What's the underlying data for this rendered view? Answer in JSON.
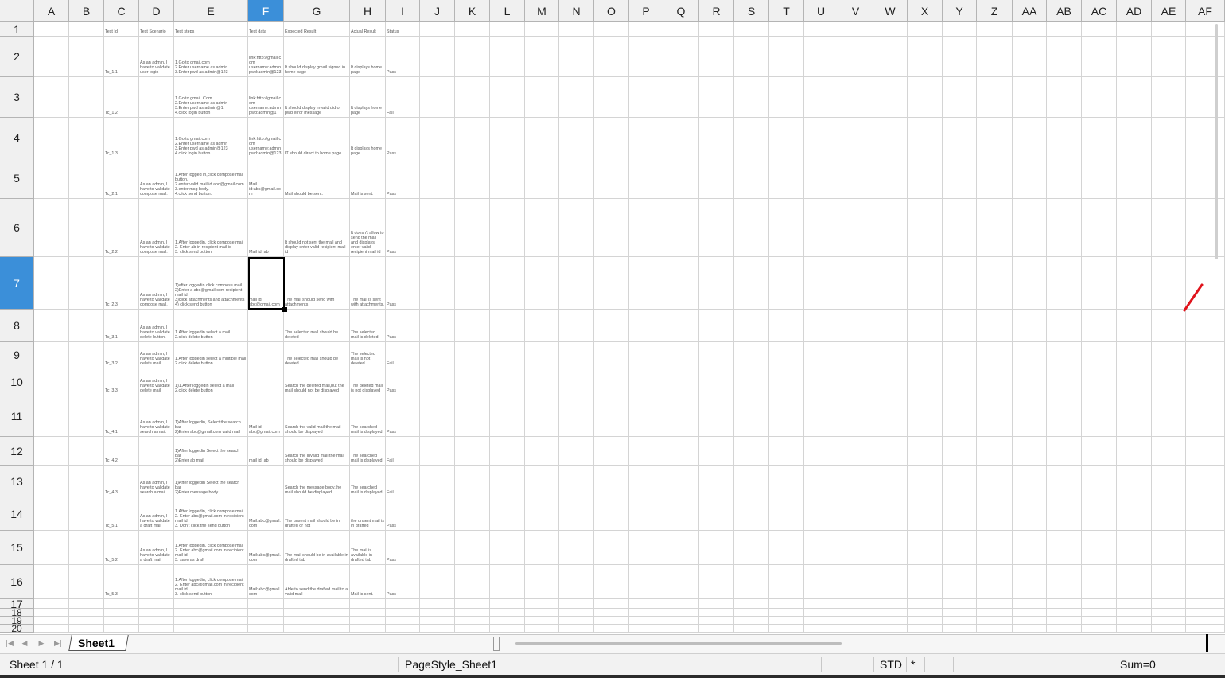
{
  "column_headers": [
    "A",
    "B",
    "C",
    "D",
    "E",
    "F",
    "G",
    "H",
    "I",
    "J",
    "K",
    "L",
    "M",
    "N",
    "O",
    "P",
    "Q",
    "R",
    "S",
    "T",
    "U",
    "V",
    "W",
    "X",
    "Y",
    "Z",
    "AA",
    "AB",
    "AC",
    "AD",
    "AE",
    "AF"
  ],
  "active_column": "F",
  "row_headers": [
    "1",
    "2",
    "3",
    "4",
    "5",
    "6",
    "7",
    "8",
    "9",
    "10",
    "11",
    "12",
    "13",
    "14",
    "15",
    "16",
    "17",
    "18",
    "19",
    "20"
  ],
  "active_row": "7",
  "rows": [
    {
      "row": "1",
      "C": "Test Id",
      "D": "Test Scenario",
      "E": "Test steps",
      "F": "Test data",
      "G": "Expected Result",
      "H": "Actual Result",
      "I": "Status"
    },
    {
      "row": "2",
      "C": "Tc_1.1",
      "D": "As an admin, I have to validate user login",
      "E": "1.Go to gmail.com\n2.Enter username as admin\n3.Enter pwd as admin@123",
      "F": "link:http://gmail.com\nusername:admin\npwd:admin@123",
      "G": "It should display gmail signed in home page",
      "H": "It displays home page",
      "I": "Pass"
    },
    {
      "row": "3",
      "C": "Tc_1.2",
      "D": "",
      "E": "1.Go to gmail. Com\n2.Enter username as admin\n3.Enter pwd as admin@1\n4.click login button",
      "F": "link:http://gmail.com\nusername:admin\npwd:admin@1",
      "G": "It should display invalid uid or pwd error message",
      "H": "It displays home page",
      "I": "Fail"
    },
    {
      "row": "4",
      "C": "Tc_1.3",
      "D": "",
      "E": "1.Go to gmail.com\n2.Enter username as admin\n3.Enter pwd as admin@123\n4.click login button",
      "F": "link:http://gmail.com\nusername:admin\npwd:admin@123",
      "G": "IT should direct to home page",
      "H": "It displays home page",
      "I": "Pass"
    },
    {
      "row": "5",
      "C": "Tc_2.1",
      "D": "As an admin, I have to validate compose mail.",
      "E": "1.After logged in,click compose mail button.\n2.enter valid mail id abc@gmail.com\n3.enter msg body.\n4.click send button.",
      "F": "Mail id:abc@gmail.com",
      "G": "Mail should be sent.",
      "H": "Mail is sent.",
      "I": "Pass"
    },
    {
      "row": "6",
      "C": "Tc_2.2",
      "D": "As an admin, I have to validate compose mail.",
      "E": "1.After loggedin, click compose mail\n2. Enter ab in recipient mail id\n3. click send button",
      "F": "Mail id: ab",
      "G": "It should not sent the mail and display enter valid recipient mail id",
      "H": "It doesn't allow to send the mail and displays enter valid recipient mail id",
      "I": "Pass"
    },
    {
      "row": "7",
      "C": "Tc_2.3",
      "D": "As an admin, I have to validate compose mail.",
      "E": "1)after loggedin click compose mail\n2)Enter a abc@gmail.com recipient mail id\n3)click attachments and attachments\n4) click send button",
      "F": "mail id: abc@gmail.com",
      "G": "The mail should send with attachments",
      "H": "The mail is sent with attachments.",
      "I": "Pass"
    },
    {
      "row": "8",
      "C": "Tc_3.1",
      "D": "As an admin, I have to validate delete button.",
      "E": "1.After loggedin select a mail\n2.click delete button",
      "F": "",
      "G": "The selected mail should be deleted",
      "H": "The selected mail is deleted",
      "I": "Pass"
    },
    {
      "row": "9",
      "C": "Tc_3.2",
      "D": "As an admin, I have to validate delete mail",
      "E": "1.After loggedin select a multiple mail\n2.click delete button",
      "F": "",
      "G": "The selected mail should be deleted",
      "H": "The selected mail is not deleted",
      "I": "Fail"
    },
    {
      "row": "10",
      "C": "Tc_3.3",
      "D": "As an admin, I have to validate delete mail",
      "E": "1)1.After loggedin select a mail\n2.click delete button",
      "F": "",
      "G": "Search the deleted mail,but the mail should not be displayed",
      "H": "The deleted mail is not displayed",
      "I": "Pass"
    },
    {
      "row": "11",
      "C": "Tc_4.1",
      "D": "As an admin, I have to validate search a mail.",
      "E": "1)After loggedin, Select the search bar\n2)Enter abc@gmail.com valid mail",
      "F": "Mail id: abc@gmail.com",
      "G": "Search the valid mail,the mail should be displayed",
      "H": "The searched mail is displayed",
      "I": "Pass"
    },
    {
      "row": "12",
      "C": "Tc_4.2",
      "D": "",
      "E": "1)After loggedin Select the search bar\n2)Enter ab mail",
      "F": "mail id: ab",
      "G": "Search the Invalid mail,the mail should be displayed",
      "H": "The searched mail is displayed",
      "I": "Fail"
    },
    {
      "row": "13",
      "C": "Tc_4.3",
      "D": "As an admin, I have to validate search a mail.",
      "E": "1)After loggedin Select the search bar\n2)Enter message body",
      "F": "",
      "G": "Search the message body,the mail should be displayed",
      "H": "The searched mail is displayed",
      "I": "Fail"
    },
    {
      "row": "14",
      "C": "Tc_5.1",
      "D": "As an admin, I have to validate a draft mail",
      "E": "1.After loggedin, click compose mail\n2. Enter abc@gmail.com in recipient mail id\n3. Don't click the send button",
      "F": "Mail:abc@gmail.com",
      "G": "The unsent mail should be in drafted or not",
      "H": "the unsent mail is in drafted",
      "I": "Pass"
    },
    {
      "row": "15",
      "C": "Tc_5.2",
      "D": "As an admin, I have to validate a draft mail",
      "E": "1.After loggedin, click compose mail\n2. Enter abc@gmail.com in recipient mail id\n3. save as draft",
      "F": "Mail:abc@gmail.com",
      "G": "The mail should be in available in drafted tab",
      "H": "The mail is available in drafted tab",
      "I": "Pass"
    },
    {
      "row": "16",
      "C": "Tc_5.3",
      "D": "",
      "E": "1.After loggedin, click compose mail\n2. Enter abc@gmail.com in recipient mail id\n3. click send button",
      "F": "Mail:abc@gmail.com",
      "G": "Able to send the drafted mail to a valid mail",
      "H": "Mail is sent.",
      "I": "Pass"
    }
  ],
  "sheet_tab": "Sheet1",
  "nav_icons": [
    "first-sheet-icon",
    "prev-sheet-icon",
    "next-sheet-icon",
    "last-sheet-icon"
  ],
  "nav_glyphs": [
    "|◀",
    "◀",
    "▶",
    "▶|"
  ],
  "status": {
    "sheet_position": "Sheet 1 / 1",
    "page_style": "PageStyle_Sheet1",
    "selection_mode": "STD",
    "modified_indicator": "*",
    "sum": "Sum=0"
  },
  "colors": {
    "header_bg": "#f0f0f0",
    "active_header": "#3b8fd9",
    "grid_line": "#d4d4d4",
    "pen_mark": "#e0141c"
  }
}
